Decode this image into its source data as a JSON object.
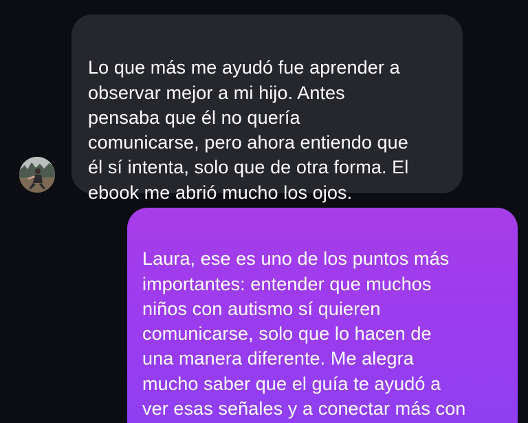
{
  "conversation": {
    "incoming_message": {
      "text": "Lo que más me ayudó fue aprender a\nobservar mejor a mi hijo. Antes\npensaba que él no quería\ncomunicarse, pero ahora entiendo que\nél sí intenta, solo que de otra forma. El\nebook me abrió mucho los ojos.",
      "avatar_icon": "user-avatar-photo"
    },
    "outgoing_message": {
      "text": "Laura, ese es uno de los puntos más\nimportantes: entender que muchos\nniños con autismo sí quieren\ncomunicarse, solo que lo hacen de\nuna manera diferente. Me alegra\nmucho saber que el guía te ayudó a\nver esas señales y a conectar más con\ntu hijo."
    }
  },
  "colors": {
    "background": "#0c0d12",
    "incoming_bubble": "#26272c",
    "outgoing_bubble_top": "#a63de8",
    "outgoing_bubble_bottom": "#8d3ff2",
    "text": "#ffffff"
  }
}
